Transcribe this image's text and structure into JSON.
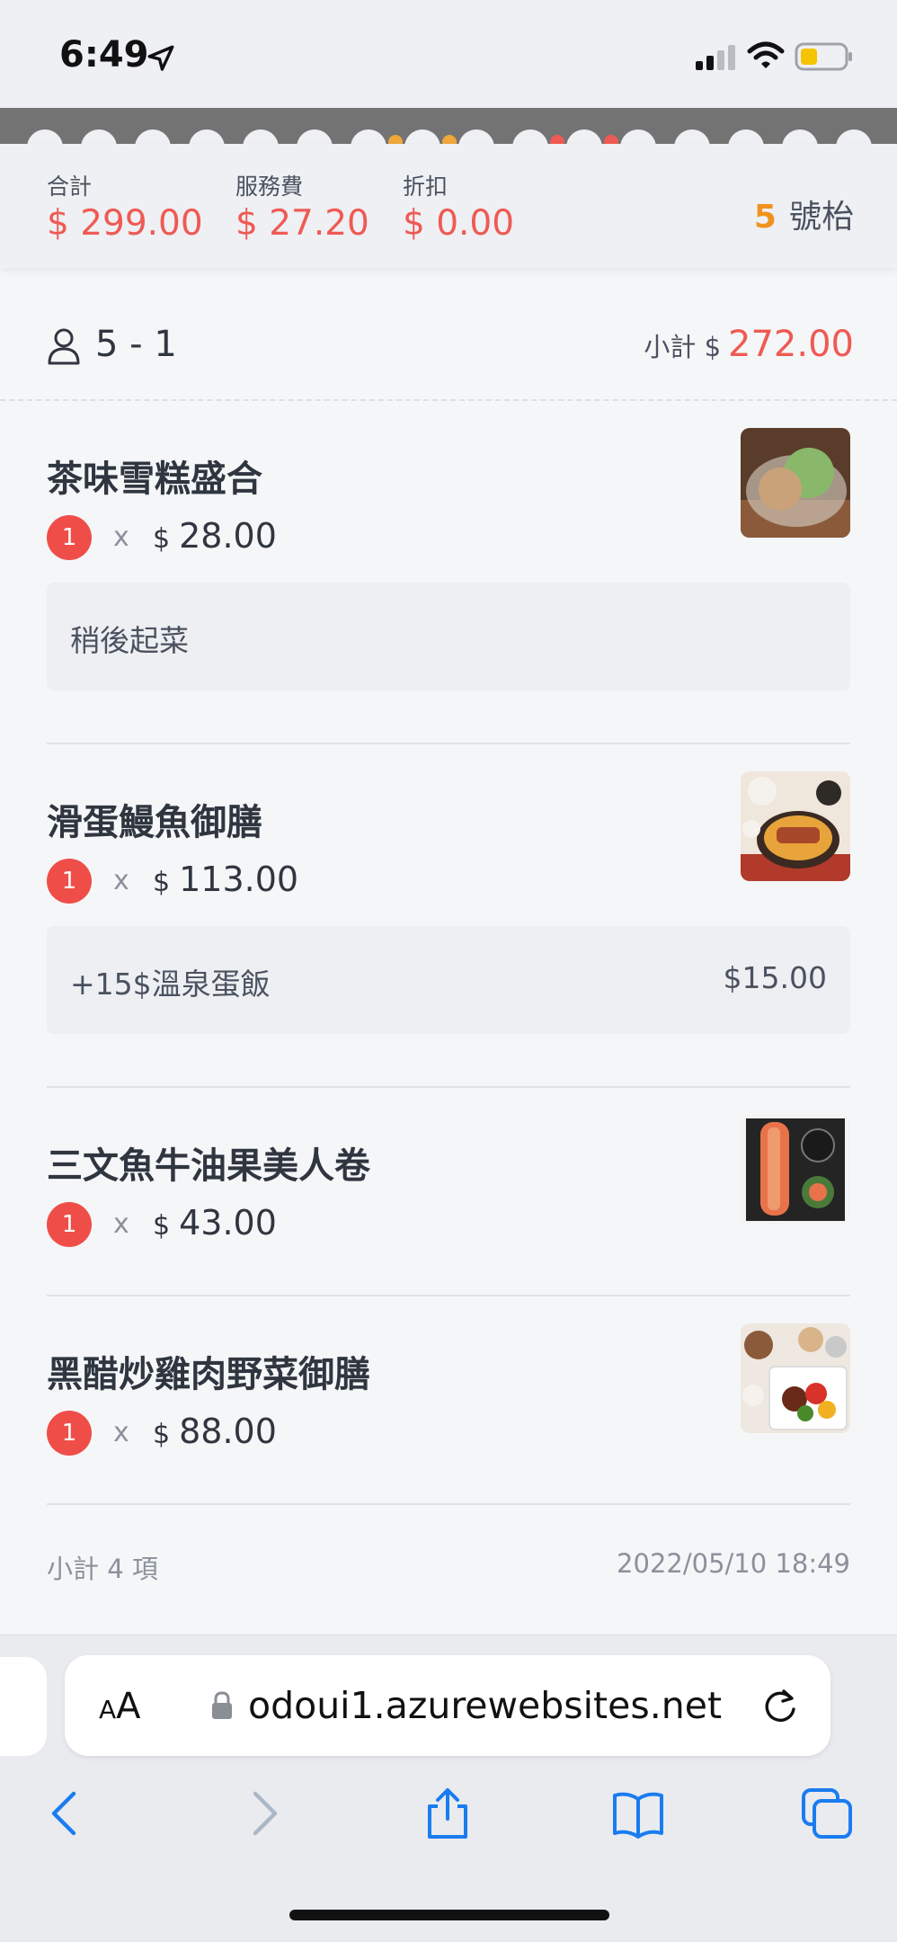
{
  "status_bar": {
    "time": "6:49"
  },
  "totals": {
    "total_label": "合計",
    "total_value": "$ 299.00",
    "service_label": "服務費",
    "service_value": "$ 27.20",
    "discount_label": "折扣",
    "discount_value": "$ 0.00",
    "table_number": "5",
    "table_suffix": "號枱"
  },
  "order": {
    "guest": "5 - 1",
    "subtotal_label": "小計 $",
    "subtotal_value": "272.00",
    "items": [
      {
        "name": "茶味雪糕盛合",
        "qty": "1",
        "x": "x",
        "currency": "$",
        "price": "28.00",
        "note": "稍後起菜",
        "note_price": ""
      },
      {
        "name": "滑蛋鰻魚御膳",
        "qty": "1",
        "x": "x",
        "currency": "$",
        "price": "113.00",
        "note": "+15$溫泉蛋飯",
        "note_price": "$15.00"
      },
      {
        "name": "三文魚牛油果美人卷",
        "qty": "1",
        "x": "x",
        "currency": "$",
        "price": "43.00"
      },
      {
        "name": "黑醋炒雞肉野菜御膳",
        "qty": "1",
        "x": "x",
        "currency": "$",
        "price": "88.00"
      }
    ],
    "footer_count": "小計 4 項",
    "footer_time": "2022/05/10 18:49"
  },
  "browser": {
    "aa_small": "A",
    "aa_large": "A",
    "url": "odoui1.azurewebsites.net"
  },
  "colors": {
    "accent_red": "#ef4e48",
    "table_orange": "#f0931e",
    "ios_blue": "#1a7cf0"
  }
}
